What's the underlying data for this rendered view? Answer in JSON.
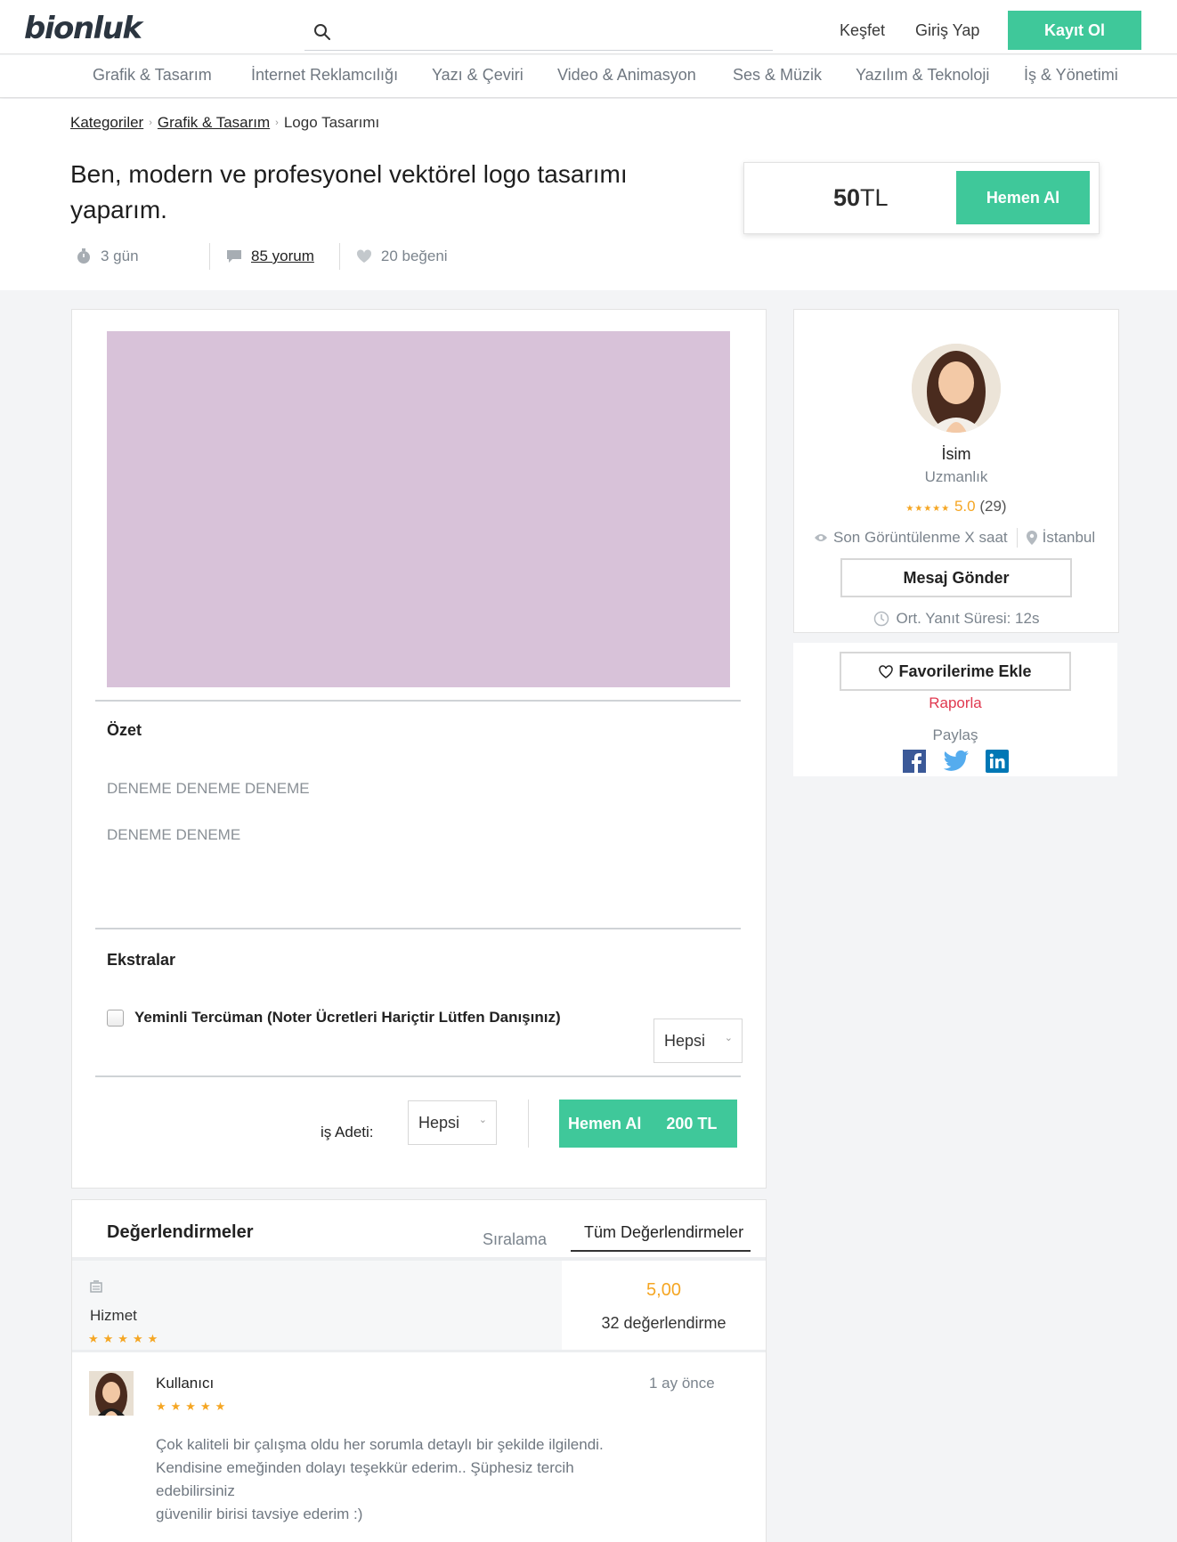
{
  "header": {
    "logo": "bionluk",
    "search_placeholder": "",
    "explore": "Keşfet",
    "login": "Giriş Yap",
    "signup": "Kayıt Ol"
  },
  "categories": [
    "Grafik & Tasarım",
    "İnternet Reklamcılığı",
    "Yazı & Çeviri",
    "Video & Animasyon",
    "Ses & Müzik",
    "Yazılım & Teknoloji",
    "İş & Yönetimi"
  ],
  "breadcrumb": [
    "Kategoriler",
    "Grafik & Tasarım",
    "Logo Tasarımı"
  ],
  "gig": {
    "title": "Ben, modern ve profesyonel vektörel logo tasarımı yaparım.",
    "duration": "3 gün",
    "reviews_link": "85 yorum",
    "likes": "20 beğeni",
    "price_value": "50",
    "price_currency": "TL",
    "buy_label": "Hemen Al"
  },
  "summary": {
    "title": "Özet",
    "lines": [
      "DENEME DENEME DENEME",
      "DENEME DENEME"
    ]
  },
  "extras": {
    "title": "Ekstralar",
    "item_label": "Yeminli Tercüman (Noter Ücretleri Hariçtir Lütfen Danışınız)",
    "item_select": "Hepsi"
  },
  "order": {
    "qty_label": "iş Adeti:",
    "qty_value": "Hepsi",
    "buy_label": "Hemen Al",
    "total": "200 TL"
  },
  "reviews": {
    "title": "Değerlendirmeler",
    "sort_label": "Sıralama",
    "sort_value": "Tüm Değerlendirmeler",
    "service_label": "Hizmet",
    "service_stars": "★★★★★",
    "average": "5,00",
    "count": "32 değerlendirme",
    "items": [
      {
        "user": "Kullanıcı",
        "stars": "★★★★★",
        "time": "1 ay önce",
        "lines": [
          "Çok kaliteli bir çalışma oldu her sorumla detaylı bir şekilde ilgilendi.",
          "Kendisine emeğinden dolayı teşekkür ederim.. Şüphesiz tercih",
          "edebilirsiniz",
          "güvenilir birisi tavsiye ederim :)"
        ]
      }
    ]
  },
  "seller": {
    "name": "İsim",
    "specialty": "Uzmanlık",
    "stars": "★★★★★",
    "rating": "5.0",
    "rating_count": "(29)",
    "last_seen": "Son Görüntülenme X saat",
    "location": "İstanbul",
    "message_btn": "Mesaj Gönder",
    "response_time": "Ort. Yanıt Süresi: 12s"
  },
  "actions": {
    "favorite": "Favorilerime Ekle",
    "report": "Raporla",
    "share": "Paylaş"
  },
  "colors": {
    "accent": "#3fc89a",
    "star": "#f5a623",
    "report": "#e0384f",
    "placeholder_image": "#d8c2d9"
  },
  "icons": [
    "search-icon",
    "stopwatch-icon",
    "comment-icon",
    "heart-icon",
    "eye-icon",
    "location-pin-icon",
    "clock-icon",
    "facebook-icon",
    "twitter-icon",
    "linkedin-icon"
  ]
}
